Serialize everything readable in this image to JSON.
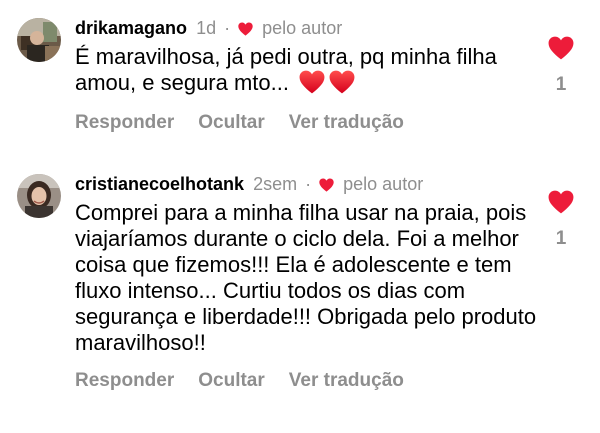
{
  "comments": [
    {
      "username": "drikamagano",
      "time": "1d",
      "separator": "·",
      "author_label": "pelo autor",
      "text": "É maravilhosa, já pedi outra, pq minha filha amou, e segura mto...",
      "emojis": [
        "red-heart-emoji",
        "red-heart-emoji"
      ],
      "actions": {
        "reply": "Responder",
        "hide": "Ocultar",
        "translate": "Ver tradução"
      },
      "likes": "1"
    },
    {
      "username": "cristianecoelhotank",
      "time": "2sem",
      "separator": "·",
      "author_label": "pelo autor",
      "text": "Comprei para a minha filha usar na praia, pois viajaríamos durante o ciclo dela. Foi a melhor coisa que fizemos!!! Ela é adolescente e tem fluxo intenso... Curtiu todos os dias com segurança e liberdade!!! Obrigada pelo produto maravilhoso!!",
      "emojis": [],
      "actions": {
        "reply": "Responder",
        "hide": "Ocultar",
        "translate": "Ver tradução"
      },
      "likes": "1"
    }
  ],
  "colors": {
    "heart": "#ed1c3a",
    "muted": "#8e8e8e",
    "text": "#000000"
  },
  "icons": {
    "author_like": "heart-icon",
    "like": "heart-icon",
    "avatar_1": "user-avatar",
    "avatar_2": "user-avatar"
  }
}
